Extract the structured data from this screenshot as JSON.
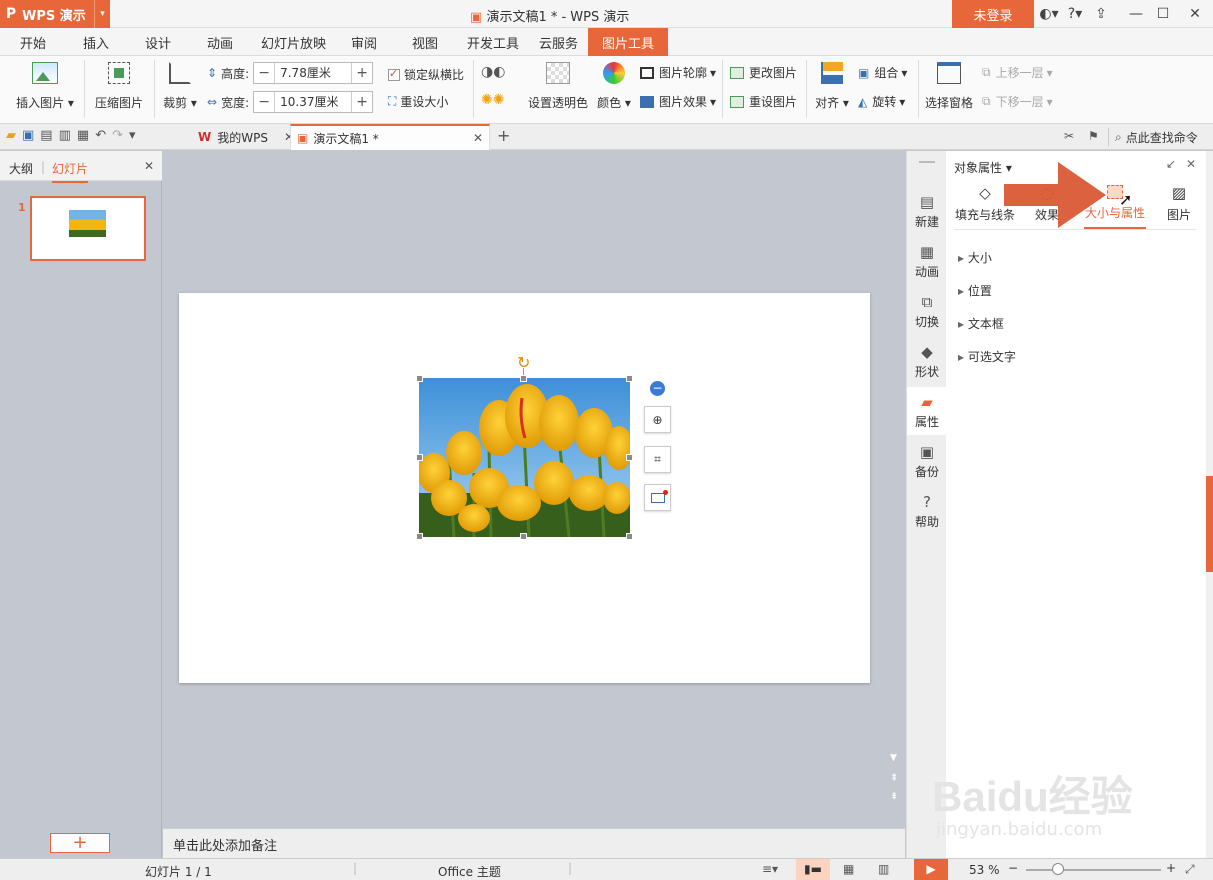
{
  "app": {
    "name": "WPS 演示",
    "doc_title": "演示文稿1 * - WPS 演示",
    "login": "未登录"
  },
  "menu": {
    "tabs": [
      "开始",
      "插入",
      "设计",
      "动画",
      "幻灯片放映",
      "审阅",
      "视图",
      "开发工具",
      "云服务",
      "图片工具"
    ],
    "active": "图片工具"
  },
  "ribbon": {
    "insert_picture": "插入图片",
    "compress_picture": "压缩图片",
    "crop": "裁剪",
    "height_label": "高度:",
    "height_value": "7.78厘米",
    "width_label": "宽度:",
    "width_value": "10.37厘米",
    "lock_ratio": "锁定纵横比",
    "reset_size": "重设大小",
    "set_transparent": "设置透明色",
    "color": "颜色",
    "picture_outline": "图片轮廓",
    "picture_effect": "图片效果",
    "change_picture": "更改图片",
    "reset_picture": "重设图片",
    "align": "对齐",
    "group": "组合",
    "rotate": "旋转",
    "selection_pane": "选择窗格",
    "bring_forward": "上移一层",
    "send_backward": "下移一层"
  },
  "tabbar": {
    "home_tab": "我的WPS",
    "doc_tab": "演示文稿1 *",
    "search": "点此查找命令"
  },
  "leftpane": {
    "outline_tab": "大纲",
    "slides_tab": "幻灯片",
    "slide_number": "1"
  },
  "notes": {
    "placeholder": "单击此处添加备注"
  },
  "sidebar": {
    "items": [
      "新建",
      "动画",
      "切换",
      "形状",
      "属性",
      "备份",
      "帮助"
    ],
    "active": "属性"
  },
  "props": {
    "header": "对象属性",
    "tabs": [
      "填充与线条",
      "效果",
      "大小与属性",
      "图片"
    ],
    "active_tab": "大小与属性",
    "sections": [
      "大小",
      "位置",
      "文本框",
      "可选文字"
    ]
  },
  "status": {
    "slide_info": "幻灯片 1 / 1",
    "theme": "Office 主题",
    "zoom": "53 %"
  },
  "watermark": {
    "brand": "Baidu经验",
    "url": "jingyan.baidu.com"
  },
  "colors": {
    "accent": "#e8673a",
    "arrow": "#d9552f"
  }
}
